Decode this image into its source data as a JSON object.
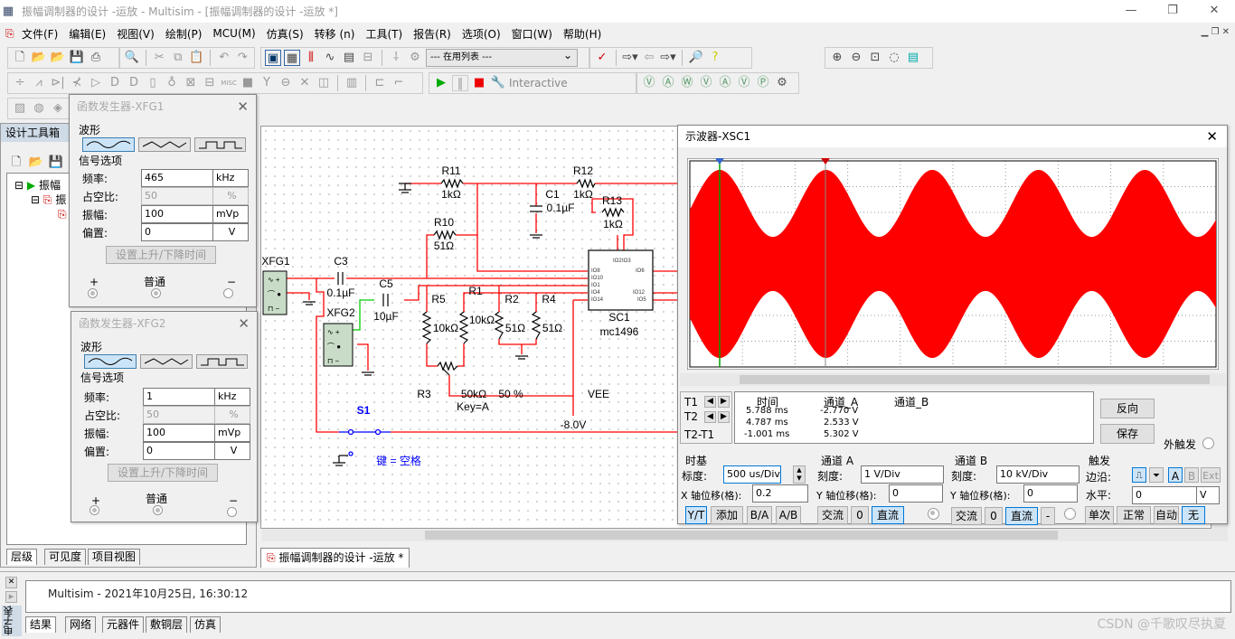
{
  "window": {
    "title": "振幅调制器的设计 -运放 - Multisim - [振幅调制器的设计 -运放 *]",
    "minimize": "—",
    "restore": "❐",
    "close": "✕"
  },
  "menu": [
    "文件(F)",
    "编辑(E)",
    "视图(V)",
    "绘制(P)",
    "MCU(M)",
    "仿真(S)",
    "转移 (n)",
    "工具(T)",
    "报告(R)",
    "选项(O)",
    "窗口(W)",
    "帮助(H)"
  ],
  "toolbar": {
    "in_use_list": "--- 在用列表 ---",
    "sim_mode": "Interactive"
  },
  "design_toolbox": {
    "title": "设计工具箱",
    "tree": [
      "振幅",
      "振",
      "振"
    ],
    "tabs": [
      "层级",
      "可见度",
      "项目视图"
    ]
  },
  "xfg1": {
    "title": "函数发生器-XFG1",
    "waveform_label": "波形",
    "signal_options": "信号选项",
    "freq_label": "频率:",
    "freq": "465",
    "freq_unit": "kHz",
    "duty_label": "占空比:",
    "duty": "50",
    "duty_unit": "%",
    "amp_label": "振幅:",
    "amp": "100",
    "amp_unit": "mVp",
    "offset_label": "偏置:",
    "offset": "0",
    "offset_unit": "V",
    "rise_fall": "设置上升/下降时间",
    "plus": "+",
    "common": "普通",
    "minus": "−",
    "selected_waveform": "sine"
  },
  "xfg2": {
    "title": "函数发生器-XFG2",
    "waveform_label": "波形",
    "signal_options": "信号选项",
    "freq_label": "频率:",
    "freq": "1",
    "freq_unit": "kHz",
    "duty_label": "占空比:",
    "duty": "50",
    "duty_unit": "%",
    "amp_label": "振幅:",
    "amp": "100",
    "amp_unit": "mVp",
    "offset_label": "偏置:",
    "offset": "0",
    "offset_unit": "V",
    "rise_fall": "设置上升/下降时间",
    "plus": "+",
    "common": "普通",
    "minus": "−",
    "selected_waveform": "sine"
  },
  "schematic": {
    "labels": {
      "r11": "R11",
      "r11v": "1kΩ",
      "r12": "R12",
      "r12v": "1kΩ",
      "c1": "C1",
      "c1v": "0.1µF",
      "r13": "R13",
      "r13v": "1kΩ",
      "r10": "R10",
      "r10v": "51Ω",
      "xfg1": "XFG1",
      "c3": "C3",
      "c3v": "0.1µF",
      "c5": "C5",
      "c5v": "10µF",
      "xfg2": "XFG2",
      "r5": "R5",
      "r5v": "10kΩ",
      "r1": "R1",
      "r1v": "10kΩ",
      "r2": "R2",
      "r2v": "51Ω",
      "r4": "R4",
      "r4v": "51Ω",
      "sc1": "SC1",
      "sc1v": "mc1496",
      "r3": "R3",
      "r3v": "50kΩ",
      "r3p": "50 %",
      "r3k": "Key=A",
      "vee": "VEE",
      "veev": "-8.0V",
      "s1": "S1",
      "s1k": "键 = 空格"
    },
    "ic_pins": [
      "IO8",
      "IO10",
      "IO1",
      "IO4",
      "IO14",
      "IO6",
      "IO12",
      "IO5",
      "IO2",
      "IO3"
    ],
    "wire_color": "#ff0000"
  },
  "scope": {
    "title": "示波器-XSC1",
    "trace_color": "#ff0000",
    "readout": {
      "headers": [
        "时间",
        "通道_A",
        "通道_B"
      ],
      "rows": [
        {
          "label": "T1",
          "time": "5.788 ms",
          "a": "-2.770 V",
          "b": ""
        },
        {
          "label": "T2",
          "time": "4.787 ms",
          "a": "2.533 V",
          "b": ""
        },
        {
          "label": "T2-T1",
          "time": "-1.001 ms",
          "a": "5.302 V",
          "b": ""
        }
      ]
    },
    "reverse": "反向",
    "save": "保存",
    "ext_trigger": "外触发",
    "timebase": {
      "title": "时基",
      "scale_label": "标度:",
      "scale": "500 us/Div",
      "xpos_label": "X 轴位移(格):",
      "xpos": "0.2",
      "modes": [
        "Y/T",
        "添加",
        "B/A",
        "A/B"
      ],
      "active_mode": "Y/T"
    },
    "channel_a": {
      "title": "通道 A",
      "scale_label": "刻度:",
      "scale": "1  V/Div",
      "ypos_label": "Y 轴位移(格):",
      "ypos": "0",
      "coupling": [
        "交流",
        "0",
        "直流"
      ],
      "active": "直流"
    },
    "channel_b": {
      "title": "通道 B",
      "scale_label": "刻度:",
      "scale": "10 kV/Div",
      "ypos_label": "Y 轴位移(格):",
      "ypos": "0",
      "coupling": [
        "交流",
        "0",
        "直流",
        "-"
      ],
      "active": "直流"
    },
    "trigger": {
      "title": "触发",
      "edge_label": "边沿:",
      "source": [
        "A",
        "B",
        "Ext"
      ],
      "level_label": "水平:",
      "level": "0",
      "level_unit": "V",
      "modes": [
        "单次",
        "正常",
        "自动",
        "无"
      ],
      "active_mode": "无"
    },
    "cursor_t1_ms": 5.788,
    "cursor_t2_ms": 4.787
  },
  "doc_tab": "振幅调制器的设计 -运放 *",
  "output": {
    "message": "Multisim  -  2021年10月25日, 16:30:12",
    "side_label": "电子表",
    "tabs": [
      "结果",
      "网络",
      "元器件",
      "敷铜层",
      "仿真"
    ]
  },
  "watermark": "CSDN @千歌叹尽执夏"
}
